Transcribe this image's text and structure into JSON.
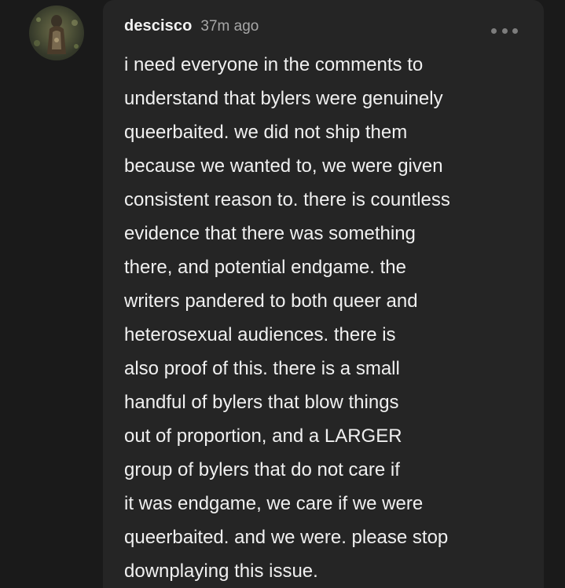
{
  "comment": {
    "username": "descisco",
    "timestamp": "37m ago",
    "more_icon": "more-horizontal-icon",
    "body_lines": [
      "i need everyone in the comments to",
      "understand that bylers were genuinely",
      "queerbaited. we did not ship them",
      "because we wanted to, we were given",
      "consistent reason to. there is countless",
      "evidence that there was something",
      "there, and potential endgame. the",
      "writers pandered to both queer and",
      "heterosexual audiences. there is",
      "also proof of this. there is a small",
      "handful of bylers that blow things",
      "out of proportion, and a LARGER",
      "group of bylers that do not care if",
      "it was endgame, we care if we were",
      "queerbaited. and we were. please stop",
      "downplaying this issue."
    ]
  },
  "colors": {
    "page_background": "#1a1a1a",
    "card_background": "#252525",
    "text": "#f0f0f0",
    "muted_text": "#a7a7a7",
    "icon": "#7d7d7d"
  }
}
